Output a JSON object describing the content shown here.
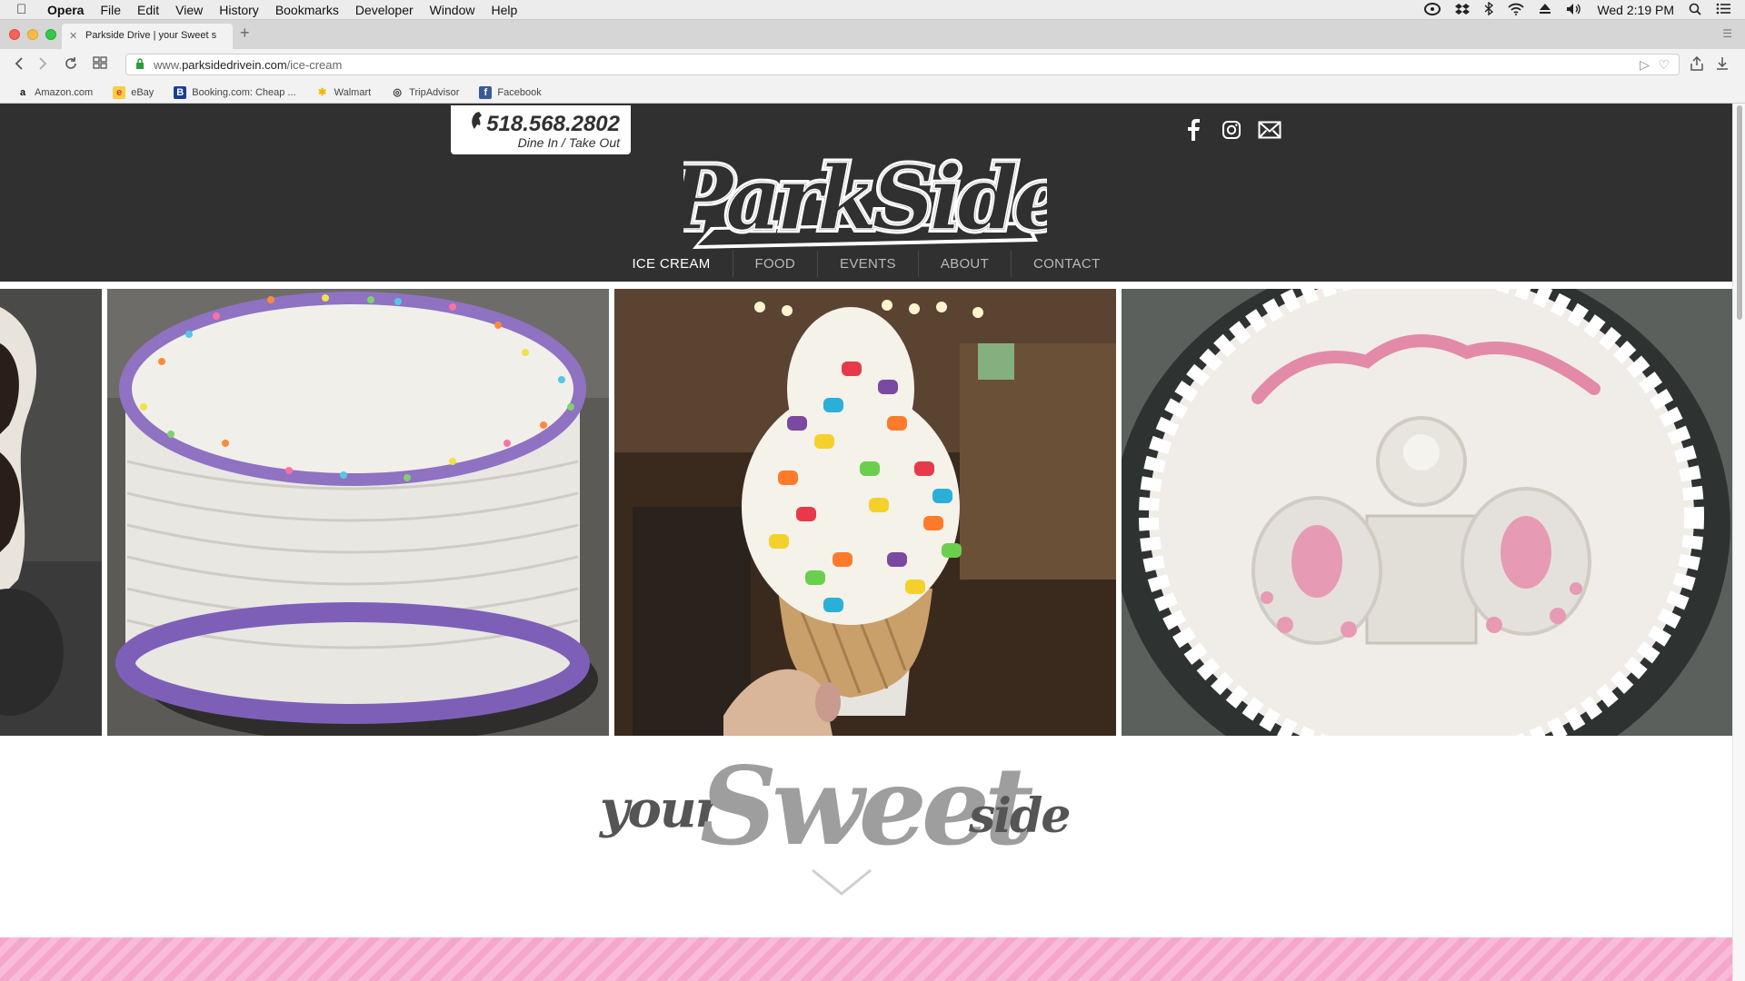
{
  "menubar": {
    "app": "Opera",
    "items": [
      "File",
      "Edit",
      "View",
      "History",
      "Bookmarks",
      "Developer",
      "Window",
      "Help"
    ],
    "clock": "Wed 2:19 PM"
  },
  "browser": {
    "tab_title": "Parkside Drive | your Sweet s",
    "url_prefix": "www.",
    "url_domain": "parksidedrivein.com",
    "url_path": "/ice-cream",
    "bookmarks": [
      {
        "label": "Amazon.com",
        "icon": "a"
      },
      {
        "label": "eBay",
        "icon": "e"
      },
      {
        "label": "Booking.com: Cheap ...",
        "icon": "B"
      },
      {
        "label": "Walmart",
        "icon": "✱"
      },
      {
        "label": "TripAdvisor",
        "icon": "◎"
      },
      {
        "label": "Facebook",
        "icon": "f"
      }
    ]
  },
  "header": {
    "phone": "518.568.2802",
    "phone_sub": "Dine In / Take Out",
    "logo_text": "ParkSide",
    "social": [
      "facebook-icon",
      "instagram-icon",
      "mail-icon"
    ]
  },
  "nav": {
    "items": [
      "ICE CREAM",
      "FOOD",
      "EVENTS",
      "ABOUT",
      "CONTACT"
    ],
    "active": "ICE CREAM"
  },
  "tagline": {
    "your": "your",
    "sweet": "Sweet",
    "side": "side"
  },
  "colors": {
    "header_bg": "#303030",
    "accent_pink": "#f5a7cb",
    "active_nav": "#ffffff"
  }
}
